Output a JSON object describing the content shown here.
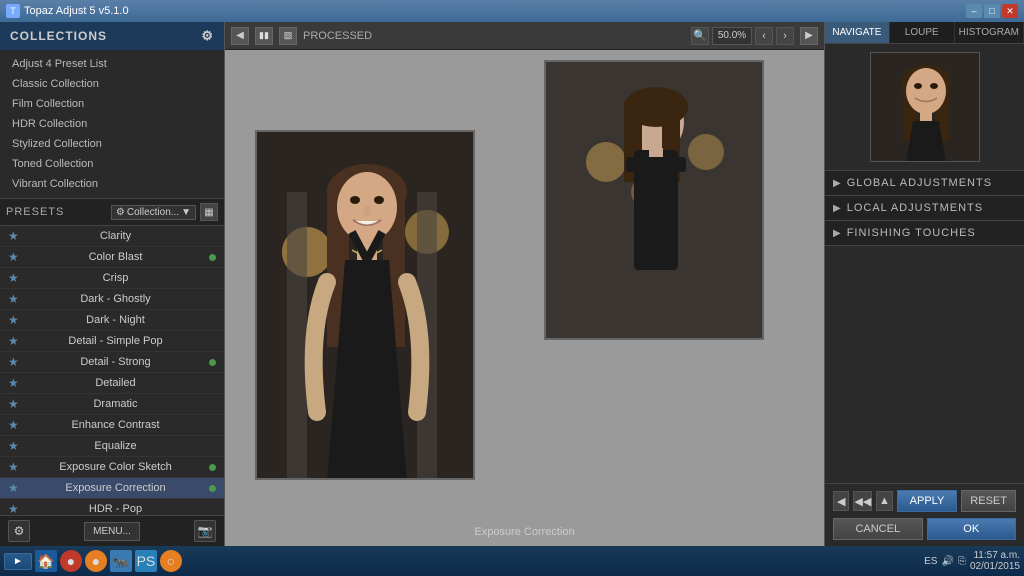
{
  "app": {
    "title": "Topaz Adjust 5 v5.1.0"
  },
  "collections_header": {
    "label": "COLLECTIONS"
  },
  "collections_list": {
    "items": [
      {
        "label": "Adjust 4 Preset List"
      },
      {
        "label": "Classic Collection"
      },
      {
        "label": "Film Collection"
      },
      {
        "label": "HDR Collection"
      },
      {
        "label": "Stylized Collection"
      },
      {
        "label": "Toned Collection"
      },
      {
        "label": "Vibrant Collection"
      }
    ]
  },
  "presets": {
    "label": "PRESETS",
    "dropdown_label": "Collection...",
    "items": [
      {
        "name": "Clarity",
        "has_dot": false,
        "active": false
      },
      {
        "name": "Color Blast",
        "has_dot": true,
        "active": false
      },
      {
        "name": "Crisp",
        "has_dot": false,
        "active": false
      },
      {
        "name": "Dark - Ghostly",
        "has_dot": false,
        "active": false
      },
      {
        "name": "Dark - Night",
        "has_dot": false,
        "active": false
      },
      {
        "name": "Detail - Simple Pop",
        "has_dot": false,
        "active": false
      },
      {
        "name": "Detail - Strong",
        "has_dot": true,
        "active": false
      },
      {
        "name": "Detailed",
        "has_dot": false,
        "active": false
      },
      {
        "name": "Dramatic",
        "has_dot": false,
        "active": false
      },
      {
        "name": "Enhance Contrast",
        "has_dot": false,
        "active": false
      },
      {
        "name": "Equalize",
        "has_dot": false,
        "active": false
      },
      {
        "name": "Exposure Color Sketch",
        "has_dot": true,
        "active": false
      },
      {
        "name": "Exposure Correction",
        "has_dot": true,
        "active": true
      },
      {
        "name": "HDR - Pop",
        "has_dot": false,
        "active": false
      }
    ]
  },
  "toolbar": {
    "processed_label": "PROCESSED",
    "zoom_value": "50.0%"
  },
  "image": {
    "label": "Exposure Correction"
  },
  "right_tabs": [
    {
      "label": "NAVIGATE",
      "active": true
    },
    {
      "label": "LOUPE",
      "active": false
    },
    {
      "label": "HISTOGRAM",
      "active": false
    }
  ],
  "right_sections": [
    {
      "label": "GLOBAL ADJUSTMENTS"
    },
    {
      "label": "LOCAL ADJUSTMENTS"
    },
    {
      "label": "FINISHING TOUCHES"
    }
  ],
  "buttons": {
    "apply": "APPLY",
    "reset": "RESET",
    "cancel": "CANCEL",
    "ok": "OK",
    "menu": "MENU..."
  },
  "taskbar": {
    "time": "11:57 a.m.",
    "date": "02/01/2015",
    "lang": "ES"
  }
}
